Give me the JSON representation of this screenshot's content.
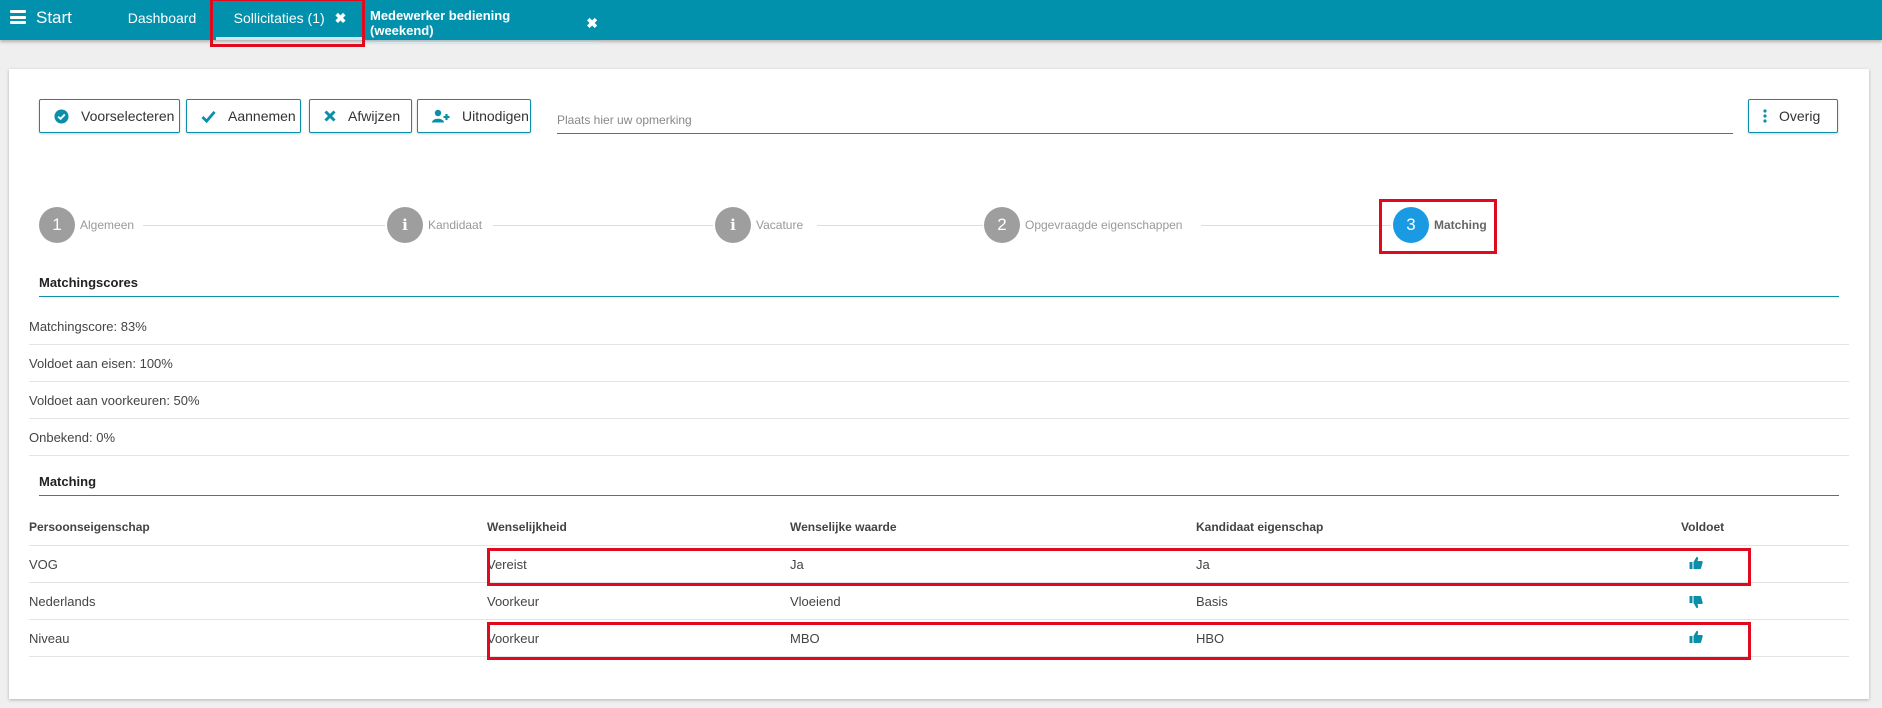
{
  "topbar": {
    "start_label": "Start",
    "tabs": [
      {
        "label": "Dashboard",
        "closable": false
      },
      {
        "label": "Sollicitaties (1)",
        "closable": true,
        "active": true
      },
      {
        "label": "Medewerker bediening (weekend)",
        "closable": true
      }
    ],
    "close_glyph": "✖",
    "background_color": "#0291ad"
  },
  "toolbar": {
    "buttons": [
      {
        "label": "Voorselecteren",
        "icon": "check-circle-icon"
      },
      {
        "label": "Aannemen",
        "icon": "check-icon"
      },
      {
        "label": "Afwijzen",
        "icon": "close-icon"
      },
      {
        "label": "Uitnodigen",
        "icon": "add-user-icon"
      }
    ],
    "remark_placeholder": "Plaats hier uw opmerking",
    "remark_value": "",
    "overig_label": "Overig",
    "overig_icon": "more-vertical-icon"
  },
  "steps": [
    {
      "marker": "1",
      "label": "Algemeen",
      "active": false
    },
    {
      "marker": "i",
      "label": "Kandidaat",
      "active": false
    },
    {
      "marker": "i",
      "label": "Vacature",
      "active": false
    },
    {
      "marker": "2",
      "label": "Opgevraagde eigenschappen",
      "active": false
    },
    {
      "marker": "3",
      "label": "Matching",
      "active": true
    }
  ],
  "matchingscores": {
    "title": "Matchingscores",
    "rows": [
      "Matchingscore: 83%",
      "Voldoet aan eisen: 100%",
      "Voldoet aan voorkeuren: 50%",
      "Onbekend: 0%"
    ]
  },
  "matching": {
    "title": "Matching",
    "columns": [
      "Persoonseigenschap",
      "Wenselijkheid",
      "Wenselijke waarde",
      "Kandidaat eigenschap",
      "Voldoet"
    ],
    "rows": [
      {
        "eigenschap": "VOG",
        "wenselijkheid": "Vereist",
        "waarde": "Ja",
        "kandidaat": "Ja",
        "voldoet": "thumbs-up-icon"
      },
      {
        "eigenschap": "Nederlands",
        "wenselijkheid": "Voorkeur",
        "waarde": "Vloeiend",
        "kandidaat": "Basis",
        "voldoet": "thumbs-down-icon"
      },
      {
        "eigenschap": "Niveau",
        "wenselijkheid": "Voorkeur",
        "waarde": "MBO",
        "kandidaat": "HBO",
        "voldoet": "thumbs-up-icon"
      }
    ]
  },
  "colors": {
    "accent": "#0b8fa9",
    "active_step": "#1a9ae3",
    "inactive_step": "#9e9e9e",
    "highlight": "#e00a1e"
  }
}
